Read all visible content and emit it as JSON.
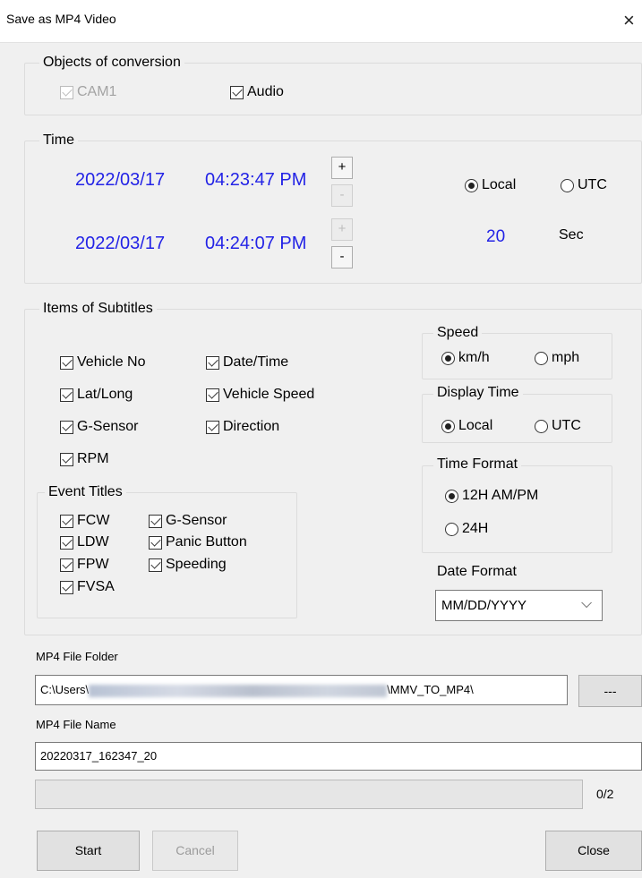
{
  "window": {
    "title": "Save as MP4 Video",
    "close_glyph": "×"
  },
  "objects": {
    "legend": "Objects of conversion",
    "cam1": {
      "label": "CAM1",
      "checked": true,
      "disabled": true
    },
    "audio": {
      "label": "Audio",
      "checked": true
    }
  },
  "time": {
    "legend": "Time",
    "start": {
      "date": "2022/03/17",
      "clock": "04:23:47 PM"
    },
    "end": {
      "date": "2022/03/17",
      "clock": "04:24:07 PM"
    },
    "spin_plus": "+",
    "spin_minus": "-",
    "zone": {
      "local": "Local",
      "utc": "UTC",
      "selected": "Local"
    },
    "duration_value": "20",
    "duration_unit": "Sec"
  },
  "subtitles": {
    "legend": "Items of Subtitles",
    "items": [
      {
        "label": "Vehicle No",
        "checked": true
      },
      {
        "label": "Date/Time",
        "checked": true
      },
      {
        "label": "Lat/Long",
        "checked": true
      },
      {
        "label": "Vehicle Speed",
        "checked": true
      },
      {
        "label": "G-Sensor",
        "checked": true
      },
      {
        "label": "Direction",
        "checked": true
      },
      {
        "label": "RPM",
        "checked": true
      }
    ],
    "event_titles": {
      "legend": "Event Titles",
      "items": [
        {
          "label": "FCW",
          "checked": true
        },
        {
          "label": "G-Sensor",
          "checked": true
        },
        {
          "label": "LDW",
          "checked": true
        },
        {
          "label": "Panic Button",
          "checked": true
        },
        {
          "label": "FPW",
          "checked": true
        },
        {
          "label": "Speeding",
          "checked": true
        },
        {
          "label": "FVSA",
          "checked": true
        }
      ]
    },
    "speed": {
      "legend": "Speed",
      "kmh": "km/h",
      "mph": "mph",
      "selected": "km/h"
    },
    "display_time": {
      "legend": "Display Time",
      "local": "Local",
      "utc": "UTC",
      "selected": "Local"
    },
    "time_format": {
      "legend": "Time Format",
      "h12": "12H AM/PM",
      "h24": "24H",
      "selected": "12H AM/PM"
    },
    "date_format": {
      "label": "Date Format",
      "value": "MM/DD/YYYY",
      "chevron": "⌵"
    }
  },
  "output": {
    "folder_label": "MP4 File Folder",
    "folder_prefix": "C:\\Users\\",
    "folder_suffix": "\\MMV_TO_MP4\\",
    "browse_label": "---",
    "name_label": "MP4 File Name",
    "name_value": "20220317_162347_20",
    "progress_fraction": 0,
    "progress_text": "0/2"
  },
  "buttons": {
    "start": "Start",
    "cancel": "Cancel",
    "close": "Close"
  }
}
